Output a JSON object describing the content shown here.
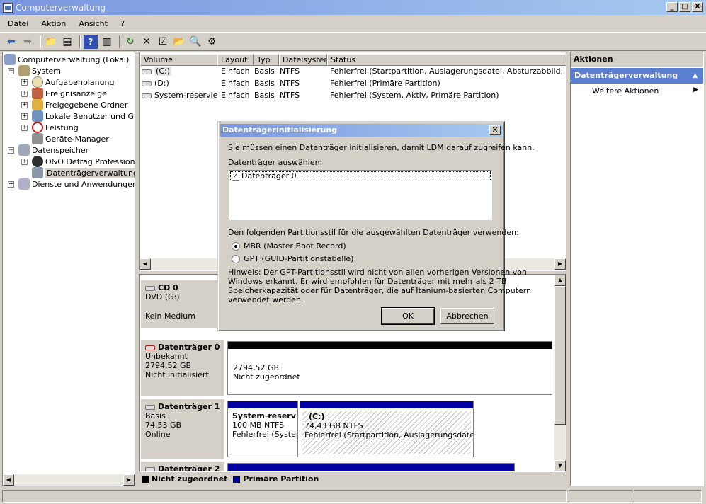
{
  "window": {
    "title": "Computerverwaltung",
    "min": "_",
    "max": "□",
    "close": "X"
  },
  "menu": [
    "Datei",
    "Aktion",
    "Ansicht",
    "?"
  ],
  "tree": {
    "root": "Computerverwaltung (Lokal)",
    "system": "System",
    "aufgaben": "Aufgabenplanung",
    "ereignis": "Ereignisanzeige",
    "freigegeben": "Freigegebene Ordner",
    "benutzer": "Lokale Benutzer und Grupp",
    "leistung": "Leistung",
    "geraete": "Geräte-Manager",
    "datenspeicher": "Datenspeicher",
    "oo": "O&O Defrag Professional I",
    "dtv": "Datenträgerverwaltung",
    "dienste": "Dienste und Anwendungen"
  },
  "list": {
    "headers": [
      "Volume",
      "Layout",
      "Typ",
      "Dateisystem",
      "Status"
    ],
    "rows": [
      [
        "(C:)",
        "Einfach",
        "Basis",
        "NTFS",
        "Fehlerfrei (Startpartition, Auslagerungsdatei, Absturzabbild, Primäre P"
      ],
      [
        "(D:)",
        "Einfach",
        "Basis",
        "NTFS",
        "Fehlerfrei (Primäre Partition)"
      ],
      [
        "System-reserviert",
        "Einfach",
        "Basis",
        "NTFS",
        "Fehlerfrei (System, Aktiv, Primäre Partition)"
      ]
    ]
  },
  "disks": {
    "cd0": {
      "name": "CD 0",
      "type": "DVD (G:)",
      "media": "Kein Medium"
    },
    "d0": {
      "name": "Datenträger 0",
      "type": "Unbekannt",
      "size": "2794,52 GB",
      "state": "Nicht initialisiert",
      "part_size": "2794,52 GB",
      "part_state": "Nicht zugeordnet"
    },
    "d1": {
      "name": "Datenträger 1",
      "type": "Basis",
      "size": "74,53 GB",
      "state": "Online",
      "p1_name": "System-reserv",
      "p1_size": "100 MB NTFS",
      "p1_status": "Fehlerfrei (Systen",
      "p2_name": "(C:)",
      "p2_size": "74,43 GB NTFS",
      "p2_status": "Fehlerfrei (Startpartition, Auslagerungsdatei, Ab"
    },
    "d2": {
      "name": "Datenträger 2"
    }
  },
  "legend": {
    "unallocated": "Nicht zugeordnet",
    "primary": "Primäre Partition",
    "unallocated_color": "#000000",
    "primary_color": "#0000a0"
  },
  "actions": {
    "title": "Aktionen",
    "section": "Datenträgerverwaltung",
    "more": "Weitere Aktionen"
  },
  "dialog": {
    "title": "Datenträgerinitialisierung",
    "intro": "Sie müssen einen Datenträger initialisieren, damit LDM darauf zugreifen kann.",
    "select_label": "Datenträger auswählen:",
    "disk_item": "Datenträger 0",
    "style_label": "Den folgenden Partitionsstil für die ausgewählten Datenträger verwenden:",
    "mbr": "MBR (Master Boot Record)",
    "gpt": "GPT (GUID-Partitionstabelle)",
    "hint1": "Hinweis: Der GPT-Partitionsstil wird nicht von allen vorherigen Versionen von",
    "hint2": "Windows erkannt. Er wird empfohlen für Datenträger mit mehr als 2 TB",
    "hint3": "Speicherkapazität oder für Datenträger, die auf Itanium-basierten Computern",
    "hint4": "verwendet werden.",
    "ok": "OK",
    "cancel": "Abbrechen"
  }
}
